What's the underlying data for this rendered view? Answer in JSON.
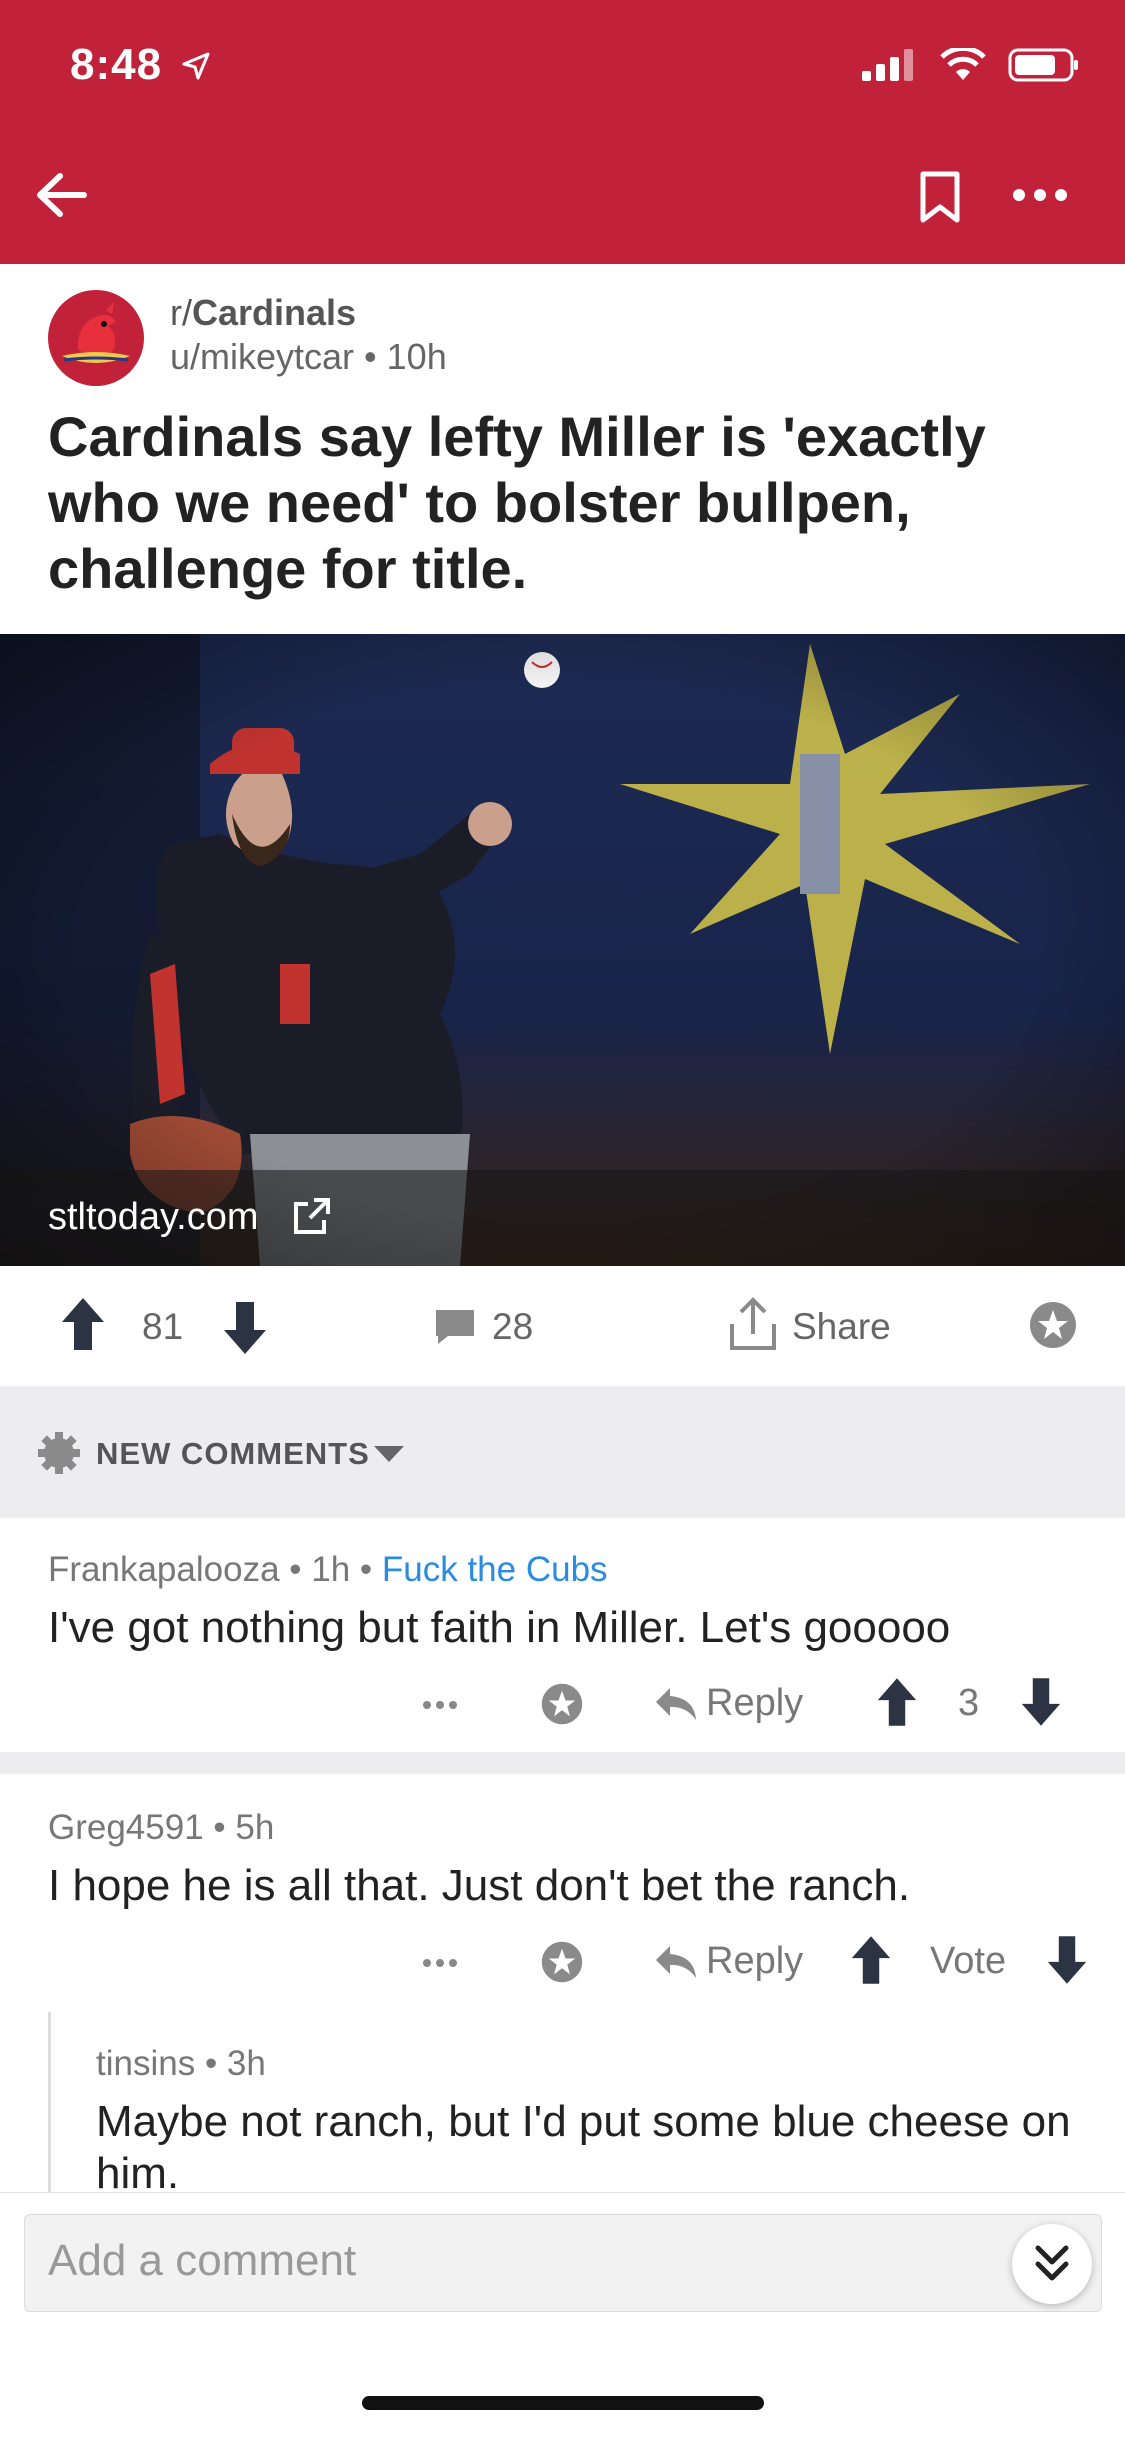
{
  "status_bar": {
    "time": "8:48"
  },
  "post": {
    "subreddit": "r/Cardinals",
    "subreddit_prefix": "r/",
    "subreddit_name": "Cardinals",
    "author": "u/mikeytcar",
    "age": "10h",
    "title": "Cardinals say lefty Miller is 'exactly who we need' to bolster bullpen, challenge for title.",
    "link_domain": "stltoday.com",
    "votes": "81",
    "comments": "28",
    "share_label": "Share"
  },
  "sort": {
    "label": "NEW COMMENTS"
  },
  "comments": [
    {
      "author": "Frankapalooza",
      "age": "1h",
      "flair": "Fuck the Cubs",
      "text": "I've got nothing but faith in Miller. Let's gooooo",
      "reply_label": "Reply",
      "score": "3"
    },
    {
      "author": "Greg4591",
      "age": "5h",
      "text": "I hope he is all that. Just don't bet the ranch.",
      "reply_label": "Reply",
      "score": "Vote"
    },
    {
      "author": "tinsins",
      "age": "3h",
      "text": "Maybe not ranch, but I'd put some blue cheese on him."
    }
  ],
  "composer": {
    "placeholder": "Add a comment"
  },
  "colors": {
    "brand": "#c2213a",
    "upvote": "#2c3444",
    "flair": "#2a8be2"
  },
  "icons": [
    "location-arrow-icon",
    "signal-icon",
    "wifi-icon",
    "battery-icon",
    "back-arrow-icon",
    "bookmark-icon",
    "more-icon",
    "external-link-icon",
    "upvote-icon",
    "downvote-icon",
    "comment-icon",
    "share-icon",
    "award-icon",
    "sort-gear-icon",
    "chevron-down-icon",
    "reply-icon",
    "jump-down-icon"
  ]
}
